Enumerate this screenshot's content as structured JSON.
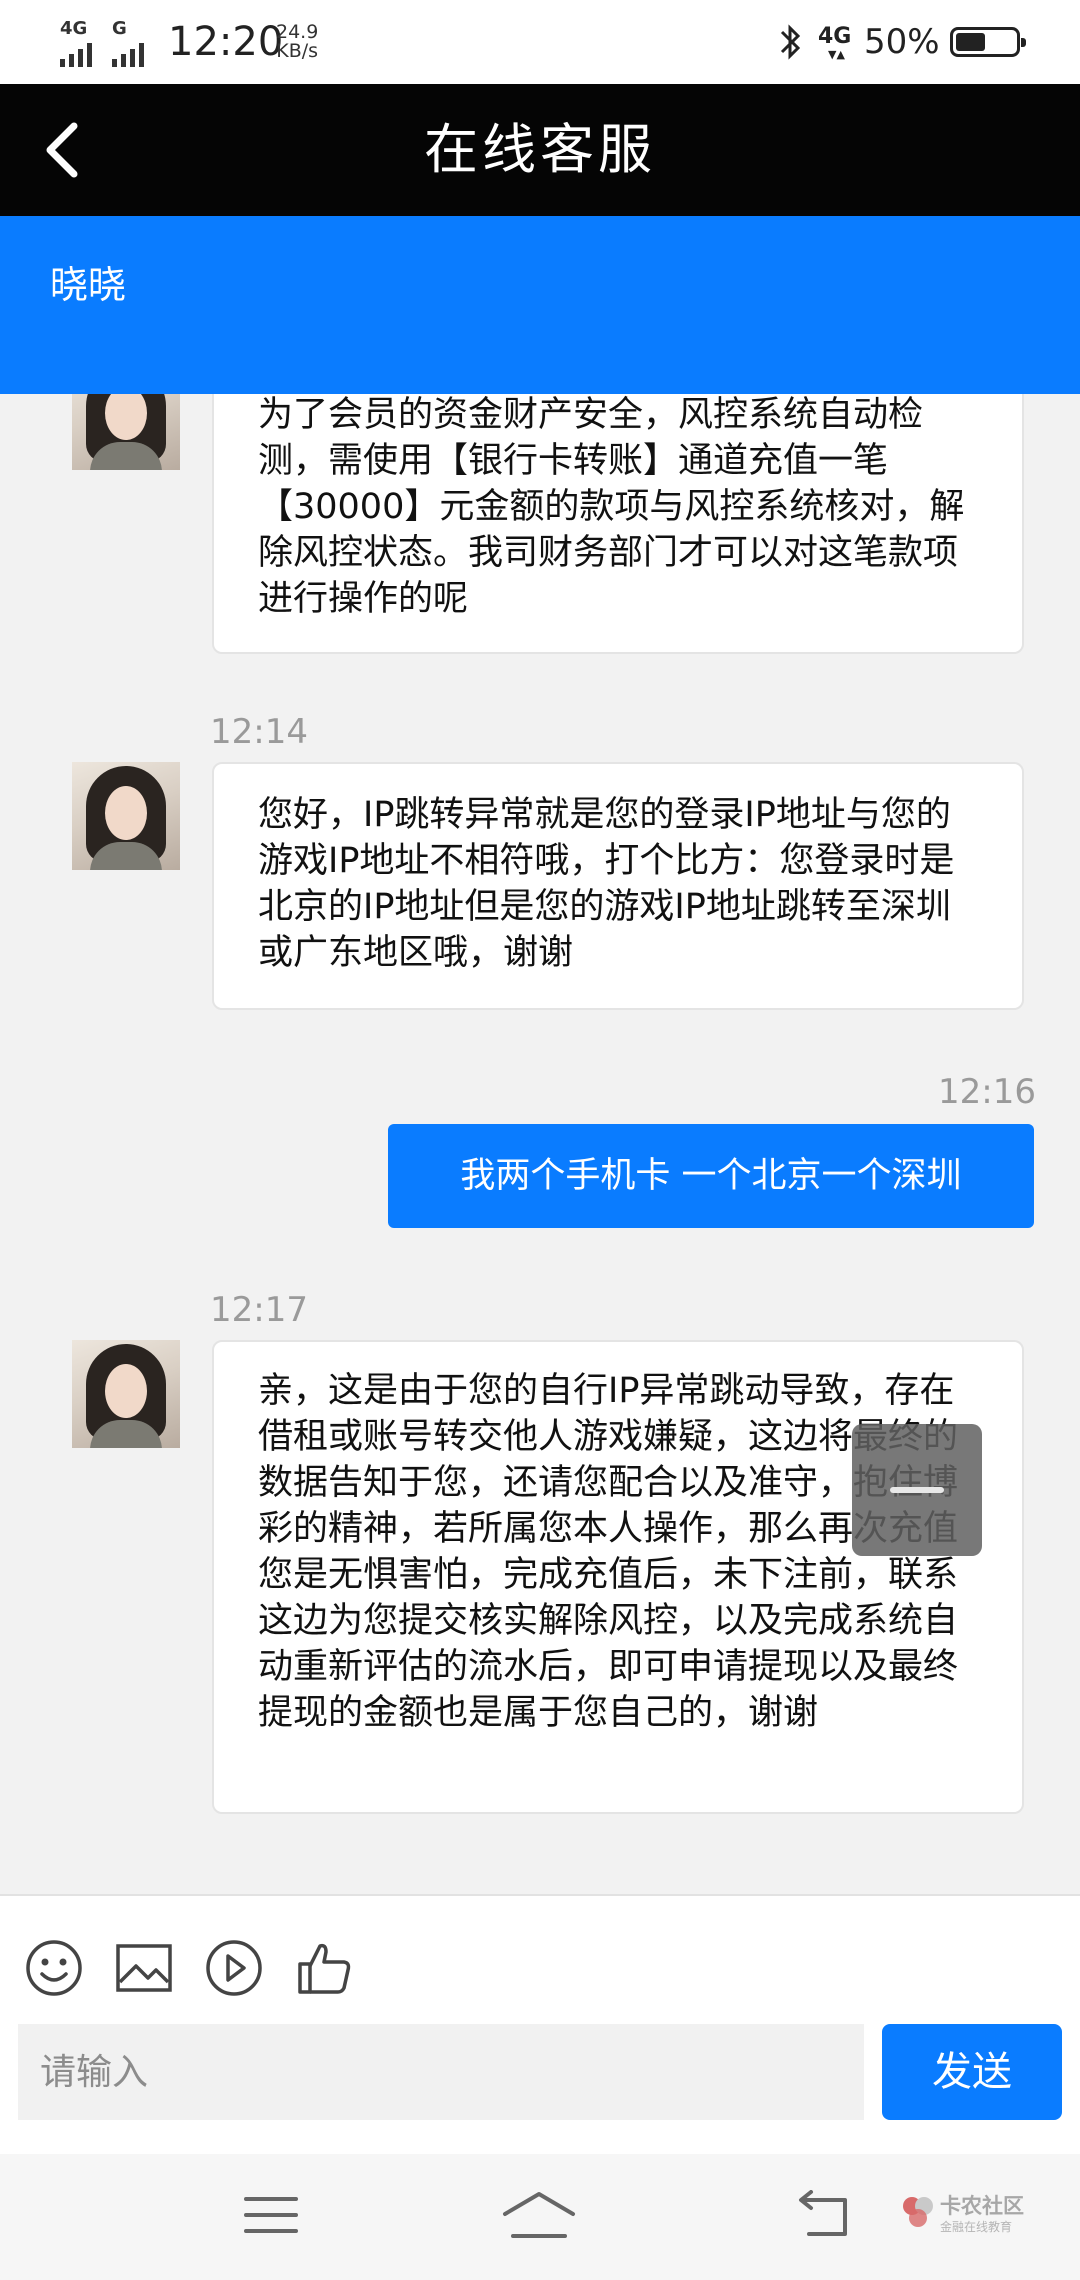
{
  "status_bar": {
    "net1": "4G",
    "net2": "G",
    "time": "12:20",
    "speed_value": "24.9",
    "speed_unit": "KB/s",
    "data_icon_label": "4G",
    "battery_text": "50%",
    "battery_level": 0.5
  },
  "header": {
    "title": "在线客服"
  },
  "agent": {
    "name": "晓晓"
  },
  "messages": [
    {
      "direction": "incoming",
      "text": "为了会员的资金财产安全，风控系统自动检测，需使用【银行卡转账】通道充值一笔【30000】元金额的款项与风控系统核对，解除风控状态。我司财务部门才可以对这笔款项进行操作的呢"
    },
    {
      "direction": "incoming",
      "time": "12:14",
      "text": "您好，IP跳转异常就是您的登录IP地址与您的游戏IP地址不相符哦，打个比方：您登录时是北京的IP地址但是您的游戏IP地址跳转至深圳或广东地区哦，谢谢"
    },
    {
      "direction": "outgoing",
      "time": "12:16",
      "text": "我两个手机卡 一个北京一个深圳"
    },
    {
      "direction": "incoming",
      "time": "12:17",
      "text": "亲，这是由于您的自行IP异常跳动导致，存在借租或账号转交他人游戏嫌疑，这边将最终的数据告知于您，还请您配合以及准守，抱住博彩的精神，若所属您本人操作，那么再次充值您是无惧害怕，完成充值后，未下注前，联系这边为您提交核实解除风控，以及完成系统自动重新评估的流水后，即可申请提现以及最终提现的金额也是属于您自己的，谢谢"
    }
  ],
  "composer": {
    "tools": [
      "emoji-icon",
      "image-icon",
      "video-icon",
      "thumbs-up-icon"
    ],
    "placeholder": "请输入",
    "send_label": "发送"
  },
  "watermark": {
    "title": "卡农社区",
    "subtitle": "金融在线教育"
  },
  "colors": {
    "accent": "#0a7cff",
    "title_bar": "#050505",
    "chat_bg": "#f2f2f2"
  }
}
